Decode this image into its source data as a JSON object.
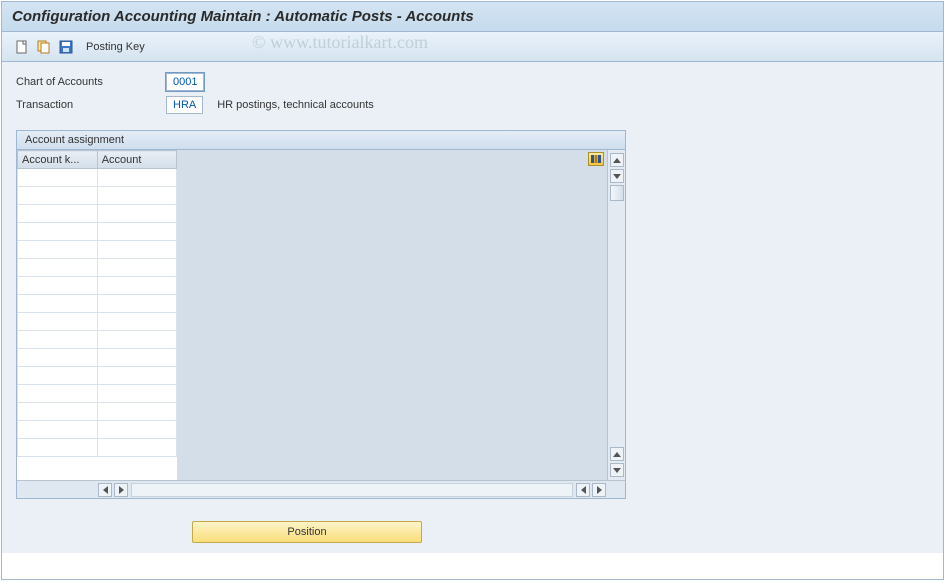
{
  "title": "Configuration Accounting Maintain : Automatic Posts - Accounts",
  "toolbar": {
    "posting_key_label": "Posting Key"
  },
  "watermark": "© www.tutorialkart.com",
  "form": {
    "chart_label": "Chart of Accounts",
    "chart_value": "0001",
    "transaction_label": "Transaction",
    "transaction_value": "HRA",
    "transaction_desc": "HR postings, technical accounts"
  },
  "panel": {
    "title": "Account assignment",
    "columns": [
      "Account k...",
      "Account"
    ],
    "rows": 16
  },
  "buttons": {
    "position": "Position"
  }
}
